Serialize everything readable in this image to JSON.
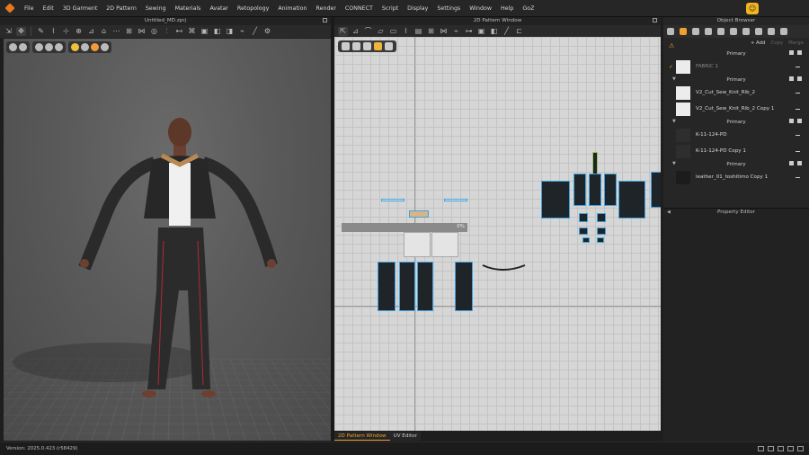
{
  "menu": [
    "File",
    "Edit",
    "3D Garment",
    "2D Pattern",
    "Sewing",
    "Materials",
    "Avatar",
    "Retopology",
    "Animation",
    "Render",
    "CONNECT",
    "Script",
    "Display",
    "Settings",
    "Window",
    "Help",
    "GoZ"
  ],
  "viewport3d": {
    "title": "Untitled_MD.zprj"
  },
  "pattern_window": {
    "title": "2D Pattern Window",
    "progress_percent": 0,
    "progress_label": "0%"
  },
  "bottom_tabs": {
    "pattern": "2D Pattern Window",
    "uv": "UV Editor"
  },
  "object_browser": {
    "title": "Object Browser",
    "actions": {
      "add": "+ Add",
      "copy": "Copy",
      "merge": "Merge"
    },
    "top_group": "Primary",
    "top_item": "FABRIC 1",
    "groups": [
      {
        "label": "Primary",
        "items": [
          "V2_Cut_Sew_Knit_Rib_2",
          "V2_Cut_Sew_Knit_Rib_2 Copy 1"
        ]
      },
      {
        "label": "Primary",
        "items": [
          "K-11-124-PD",
          "K-11-124-PD Copy 1"
        ]
      },
      {
        "label": "Primary",
        "items": [
          "leather_01_toshitimo Copy 1"
        ]
      }
    ]
  },
  "property_editor": {
    "title": "Property Editor"
  },
  "status": {
    "version": "Version: 2025.0.423 (r58429)"
  },
  "colors": {
    "accent": "#f0a030",
    "pattern_outline": "#3fa2e0",
    "progress": "#4a90d9"
  }
}
